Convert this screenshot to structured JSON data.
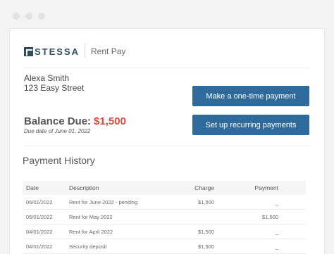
{
  "brand": {
    "logo_text": "STESSA",
    "app_name": "Rent Pay"
  },
  "tenant": {
    "name": "Alexa Smith",
    "address": "123 Easy Street"
  },
  "balance": {
    "label": "Balance Due:",
    "amount": "$1,500",
    "due_date": "Due date of June 01, 2022"
  },
  "actions": {
    "one_time": "Make a one-time payment",
    "recurring": "Set up recurring payments"
  },
  "history": {
    "title": "Payment History",
    "columns": {
      "date": "Date",
      "description": "Description",
      "charge": "Charge",
      "payment": "Payment"
    },
    "rows": [
      {
        "date": "06/01/2022",
        "description": "Rent for June 2022 - pending",
        "charge": "$1,500",
        "payment": "_"
      },
      {
        "date": "05/01/2022",
        "description": "Rent for May 2022",
        "charge": "",
        "payment": "$1,500"
      },
      {
        "date": "04/01/2022",
        "description": "Rent for April 2022",
        "charge": "$1,500",
        "payment": "_"
      },
      {
        "date": "04/01/2022",
        "description": "Security deposit",
        "charge": "$1,500",
        "payment": "_"
      }
    ]
  },
  "colors": {
    "accent": "#2f6a9c",
    "balance_amount": "#e2463b",
    "logo": "#2f4f5f"
  }
}
